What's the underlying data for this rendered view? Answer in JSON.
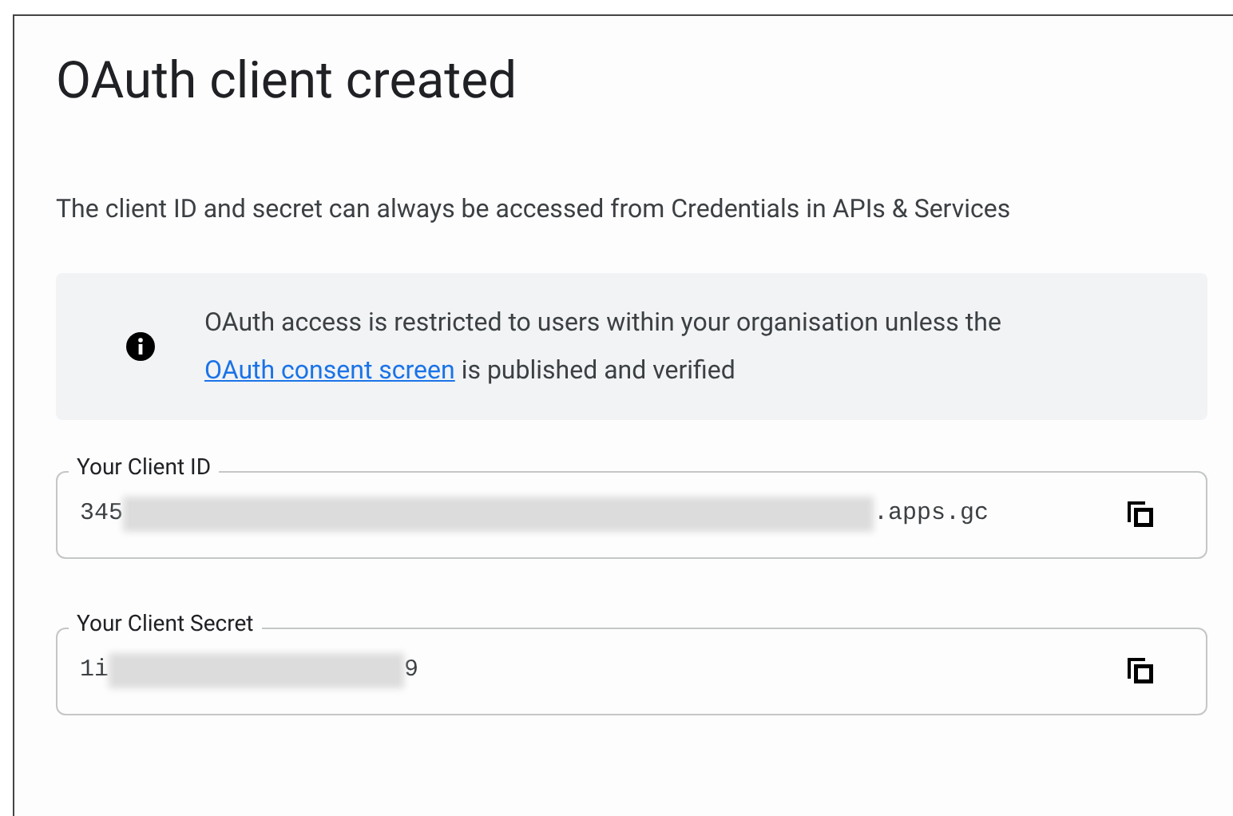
{
  "dialog": {
    "title": "OAuth client created",
    "description": "The client ID and secret can always be accessed from Credentials in APIs & Services",
    "notice": {
      "text_before": "OAuth access is restricted to users within your organisation unless the",
      "link": "OAuth consent screen",
      "text_after": "is published and verified"
    },
    "fields": [
      {
        "label": "Your Client ID",
        "value_start": "345",
        "redacted": true,
        "value_end": ".apps.gc"
      },
      {
        "label": "Your Client Secret",
        "value_start": "1i",
        "redacted": true,
        "value_end": "9"
      }
    ]
  }
}
